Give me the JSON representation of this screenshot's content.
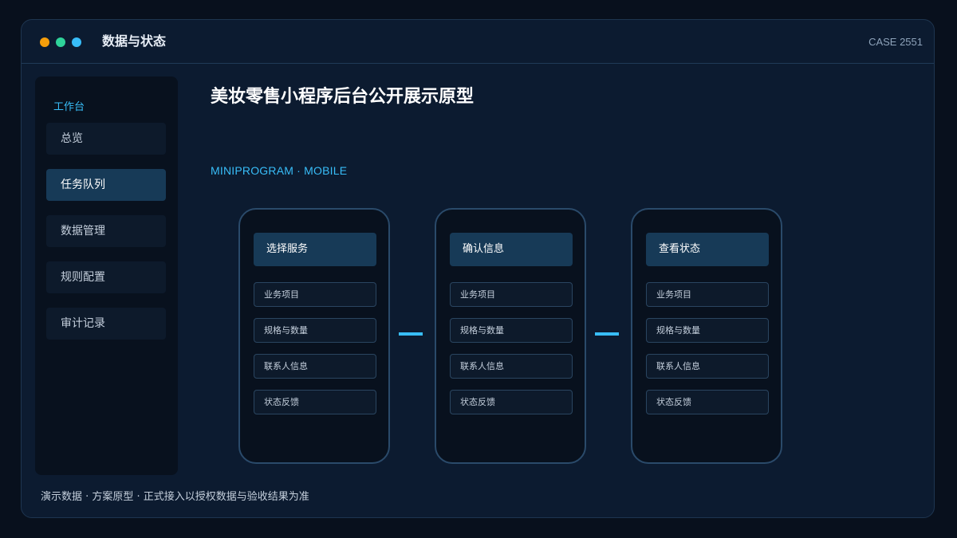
{
  "window": {
    "title": "数据与状态",
    "case_id": "CASE 2551"
  },
  "sidebar": {
    "heading": "工作台",
    "items": [
      {
        "label": "总览",
        "active": false
      },
      {
        "label": "任务队列",
        "active": true
      },
      {
        "label": "数据管理",
        "active": false
      },
      {
        "label": "规则配置",
        "active": false
      },
      {
        "label": "审计记录",
        "active": false
      }
    ]
  },
  "main": {
    "title": "美妆零售小程序后台公开展示原型",
    "subtitle": "MINIPROGRAM · MOBILE",
    "phones": [
      {
        "header": "选择服务",
        "fields": [
          "业务项目",
          "规格与数量",
          "联系人信息",
          "状态反馈"
        ]
      },
      {
        "header": "确认信息",
        "fields": [
          "业务项目",
          "规格与数量",
          "联系人信息",
          "状态反馈"
        ]
      },
      {
        "header": "查看状态",
        "fields": [
          "业务项目",
          "规格与数量",
          "联系人信息",
          "状态反馈"
        ]
      }
    ]
  },
  "footer": {
    "note": "演示数据 · 方案原型 · 正式接入以授权数据与验收结果为准"
  },
  "colors": {
    "accent": "#38bdf8",
    "dot_orange": "#f59e0b",
    "dot_green": "#2fd39a",
    "dot_blue": "#38bdf8",
    "active_nav": "#173a57"
  }
}
